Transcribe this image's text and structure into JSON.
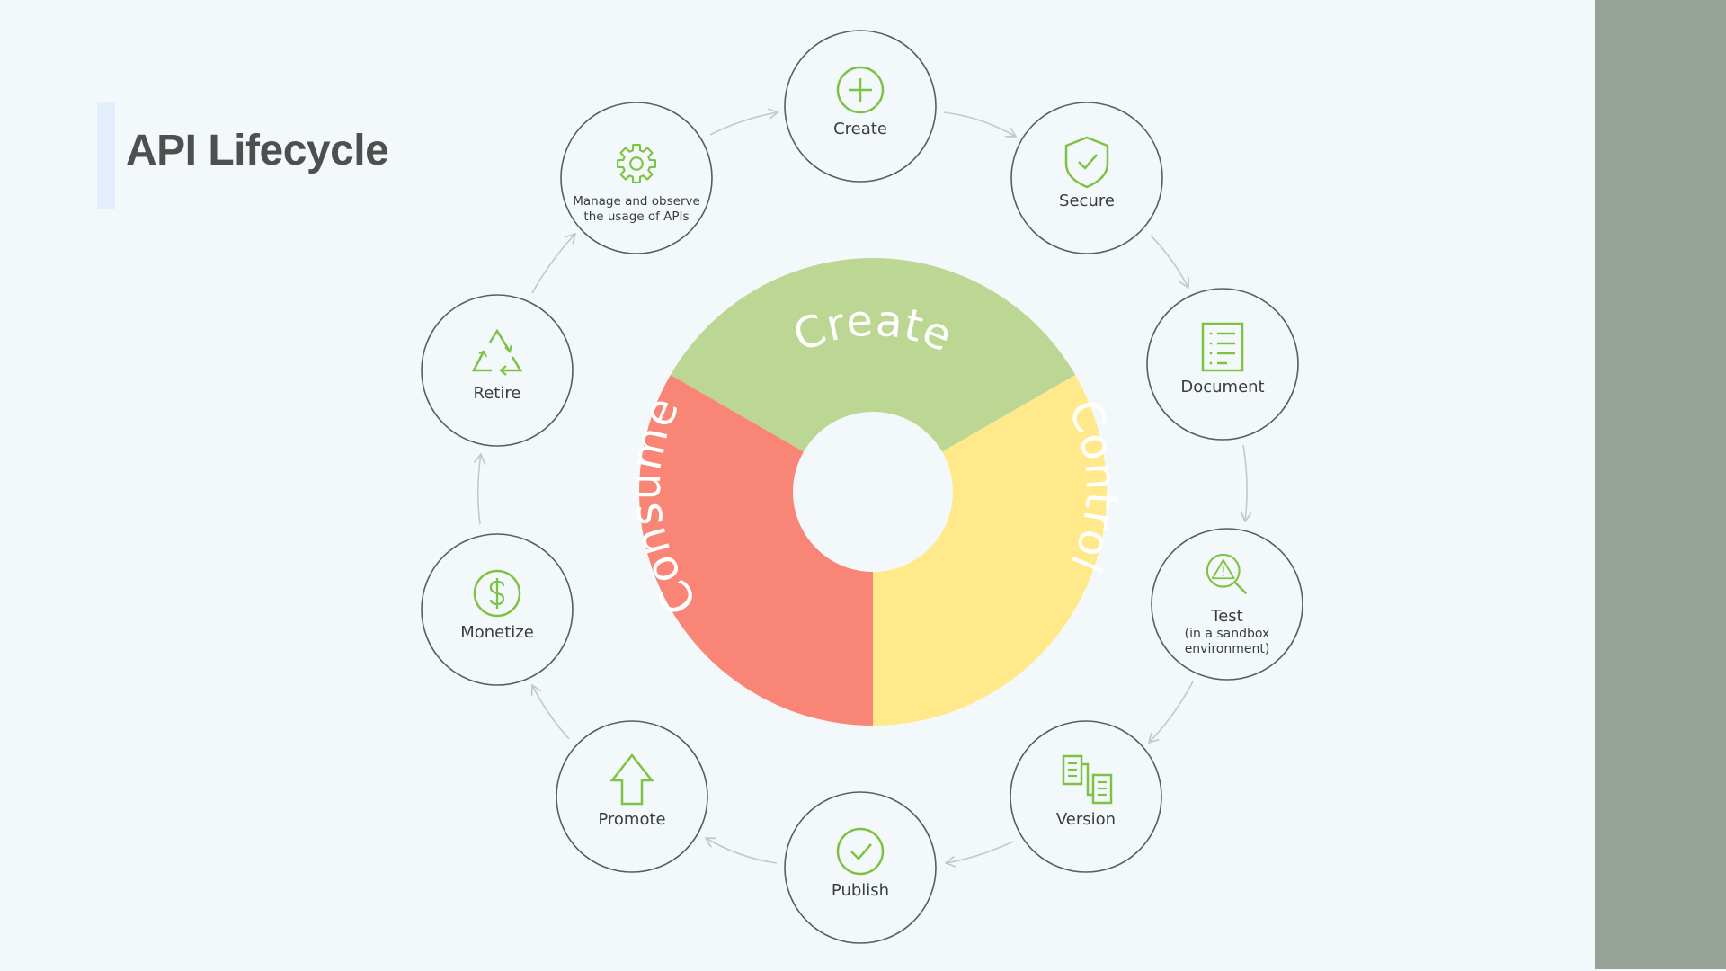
{
  "title": "API Lifecycle",
  "colors": {
    "background": "#f3f9fb",
    "side_panel": "#98a397",
    "icon_green": "#7dc242",
    "create_segment": "#bcd794",
    "control_segment": "#ffe98a",
    "consume_segment": "#f88575",
    "arrow": "#c4c8c8",
    "node_border": "#5a5e5c"
  },
  "segments": [
    {
      "id": "create",
      "label": "Create"
    },
    {
      "id": "control",
      "label": "Control"
    },
    {
      "id": "consume",
      "label": "Consume"
    }
  ],
  "nodes": [
    {
      "id": "create",
      "icon": "plus-circle-icon",
      "lines": [
        "Create"
      ]
    },
    {
      "id": "secure",
      "icon": "shield-check-icon",
      "lines": [
        "Secure"
      ]
    },
    {
      "id": "document",
      "icon": "document-list-icon",
      "lines": [
        "Document"
      ]
    },
    {
      "id": "test",
      "icon": "magnifier-warning-icon",
      "lines": [
        "Test",
        "(in a sandbox",
        "environment)"
      ]
    },
    {
      "id": "version",
      "icon": "versions-icon",
      "lines": [
        "Version"
      ]
    },
    {
      "id": "publish",
      "icon": "check-circle-icon",
      "lines": [
        "Publish"
      ]
    },
    {
      "id": "promote",
      "icon": "arrow-up-icon",
      "lines": [
        "Promote"
      ]
    },
    {
      "id": "monetize",
      "icon": "dollar-circle-icon",
      "lines": [
        "Monetize"
      ]
    },
    {
      "id": "retire",
      "icon": "recycle-icon",
      "lines": [
        "Retire"
      ]
    },
    {
      "id": "manage",
      "icon": "gear-icon",
      "lines": [
        "Manage and observe",
        "the usage of APIs"
      ]
    }
  ]
}
